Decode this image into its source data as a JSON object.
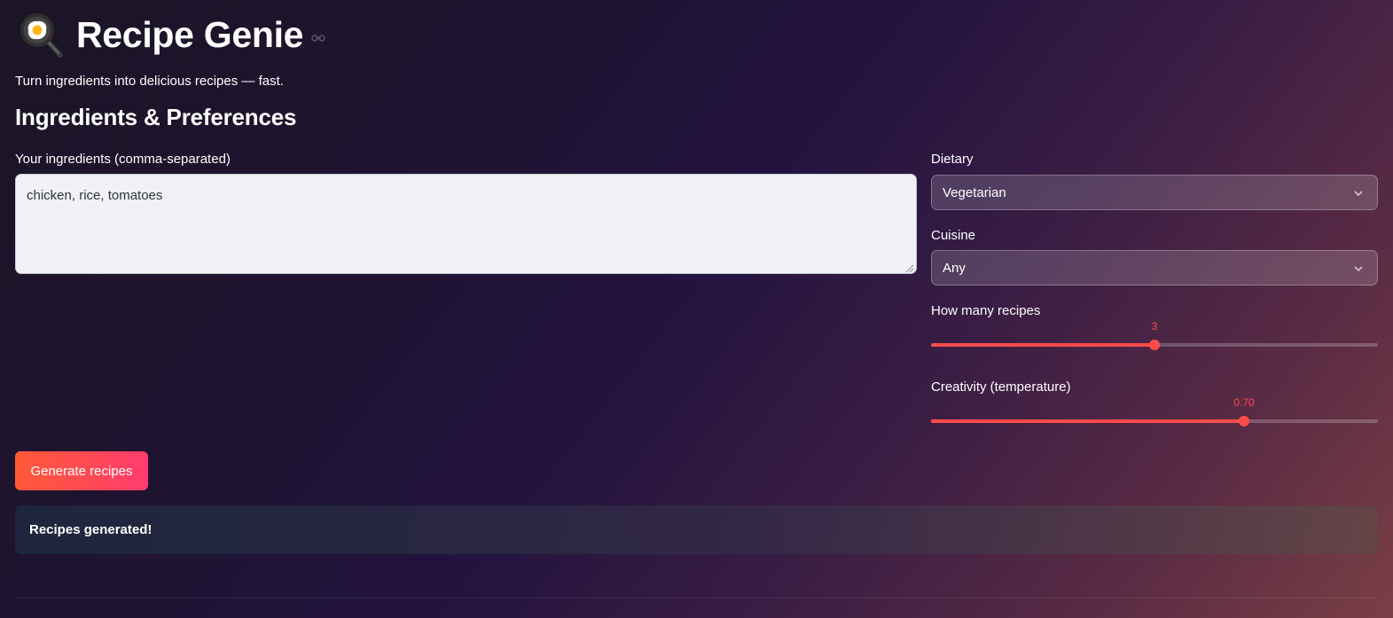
{
  "app": {
    "title": "Recipe Genie",
    "subtitle": "Turn ingredients into delicious recipes — fast.",
    "logo_icon": "frying-pan-egg-icon",
    "anchor_icon": "link-icon"
  },
  "section": {
    "heading": "Ingredients & Preferences"
  },
  "ingredients": {
    "label": "Your ingredients (comma-separated)",
    "value": "chicken, rice, tomatoes"
  },
  "dietary": {
    "label": "Dietary",
    "selected": "Vegetarian"
  },
  "cuisine": {
    "label": "Cuisine",
    "selected": "Any"
  },
  "recipes_slider": {
    "label": "How many recipes",
    "display": "3",
    "fraction": 0.5
  },
  "creativity_slider": {
    "label": "Creativity (temperature)",
    "display": "0.70",
    "fraction": 0.7
  },
  "actions": {
    "generate_label": "Generate recipes"
  },
  "status": {
    "message": "Recipes generated!"
  },
  "colors": {
    "accent": "#ff4b4b",
    "button_start": "#ff5a36",
    "button_end": "#ff3c6e"
  }
}
